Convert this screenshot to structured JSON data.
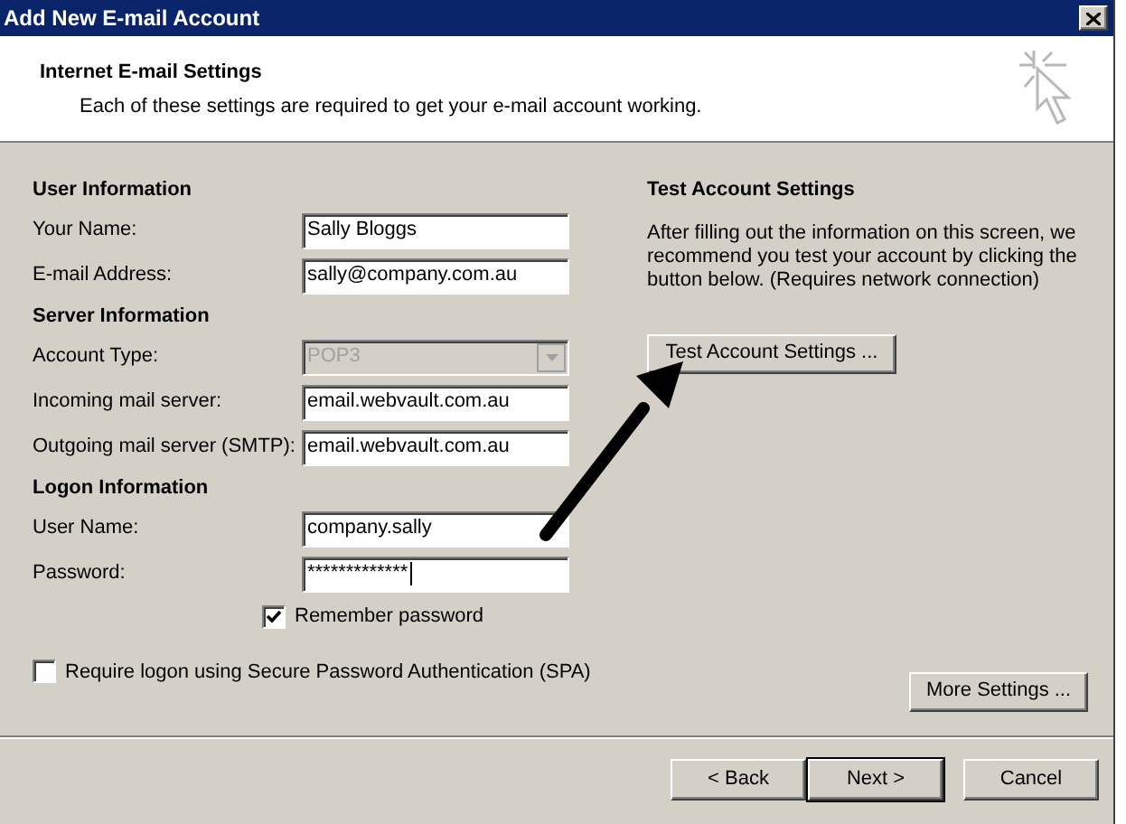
{
  "window": {
    "title": "Add New E-mail Account"
  },
  "header": {
    "title": "Internet E-mail Settings",
    "subtitle": "Each of these settings are required to get your e-mail account working."
  },
  "sections": [
    {
      "title": "User Information",
      "fields": [
        {
          "label": "Your Name:",
          "value": "Sally Bloggs",
          "kind": "text",
          "disabled": false
        },
        {
          "label": "E-mail Address:",
          "value": "sally@company.com.au",
          "kind": "text",
          "disabled": false
        }
      ]
    },
    {
      "title": "Server Information",
      "fields": [
        {
          "label": "Account Type:",
          "value": "POP3",
          "kind": "dropdown",
          "disabled": true
        },
        {
          "label": "Incoming mail server:",
          "value": "email.webvault.com.au",
          "kind": "text",
          "disabled": false
        },
        {
          "label": "Outgoing mail server (SMTP):",
          "value": "email.webvault.com.au",
          "kind": "text",
          "disabled": false
        }
      ]
    },
    {
      "title": "Logon Information",
      "fields": [
        {
          "label": "User Name:",
          "value": "company.sally",
          "kind": "text",
          "disabled": false
        },
        {
          "label": "Password:",
          "value": "*************",
          "kind": "password",
          "disabled": false
        }
      ]
    }
  ],
  "remember_password": {
    "label": "Remember password",
    "checked": true
  },
  "spa": {
    "label": "Require logon using Secure Password Authentication (SPA)",
    "checked": false
  },
  "test": {
    "title": "Test Account Settings",
    "text": "After filling out the information on this screen, we recommend you test your account by clicking the button below. (Requires network connection)",
    "button": "Test Account Settings ..."
  },
  "more_settings": "More Settings ...",
  "buttons": [
    {
      "label": "< Back",
      "default": false
    },
    {
      "label": "Next >",
      "default": true
    },
    {
      "label": "Cancel",
      "default": false
    }
  ]
}
